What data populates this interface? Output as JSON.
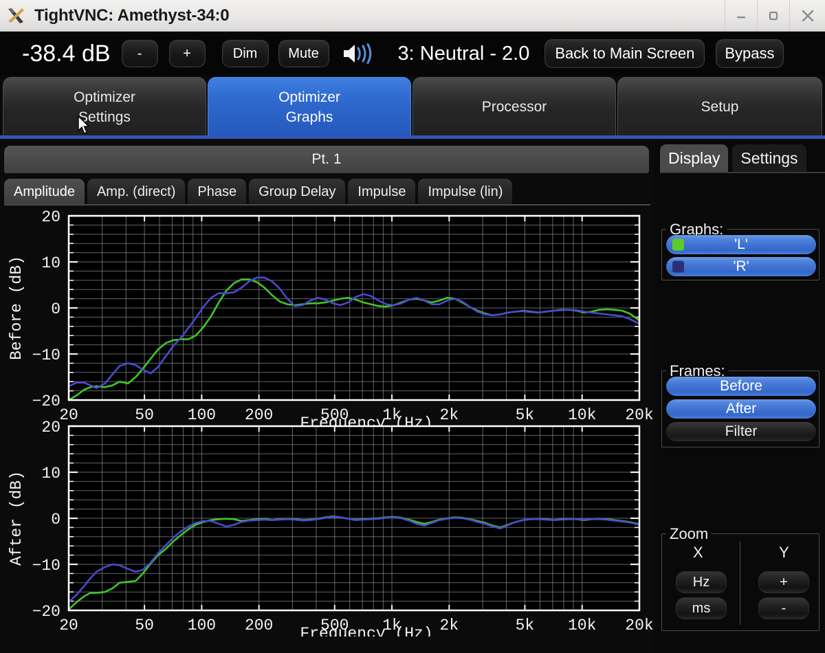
{
  "window": {
    "title": "TightVNC: Amethyst-34:0",
    "app_icon": "x-window-icon",
    "minimize_label": "–",
    "maximize_label": "□",
    "close_label": "✕"
  },
  "toolbar": {
    "volume_readout": "-38.4 dB",
    "decrease_label": "-",
    "increase_label": "+",
    "dim_label": "Dim",
    "mute_label": "Mute",
    "speaker_icon": "speaker-volume-icon",
    "preset_label": "3: Neutral - 2.0",
    "back_to_main_label": "Back to Main Screen",
    "bypass_label": "Bypass"
  },
  "main_tabs": [
    {
      "line1": "Optimizer",
      "line2": "Settings",
      "active": false
    },
    {
      "line1": "Optimizer",
      "line2": "Graphs",
      "active": true
    },
    {
      "line1": "Processor",
      "line2": "",
      "active": false
    },
    {
      "line1": "Setup",
      "line2": "",
      "active": false
    }
  ],
  "point_bar": {
    "label": "Pt. 1"
  },
  "sub_tabs": [
    {
      "label": "Amplitude",
      "active": true
    },
    {
      "label": "Amp. (direct)",
      "active": false
    },
    {
      "label": "Phase",
      "active": false
    },
    {
      "label": "Group Delay",
      "active": false
    },
    {
      "label": "Impulse",
      "active": false
    },
    {
      "label": "Impulse (lin)",
      "active": false
    }
  ],
  "sidebar": {
    "tabs": [
      {
        "label": "Display",
        "active": true
      },
      {
        "label": "Settings",
        "active": false
      }
    ],
    "graphs": {
      "legend": "Graphs:",
      "items": [
        {
          "label": "'L'",
          "active": true,
          "swatch": "#5ecb27"
        },
        {
          "label": "'R'",
          "active": true,
          "swatch": "#2b2f78"
        }
      ]
    },
    "frames": {
      "legend": "Frames:",
      "items": [
        {
          "label": "Before",
          "active": true
        },
        {
          "label": "After",
          "active": true
        },
        {
          "label": "Filter",
          "active": false
        }
      ]
    },
    "zoom": {
      "legend": "Zoom",
      "x_label": "X",
      "y_label": "Y",
      "x_buttons": [
        "Hz",
        "ms"
      ],
      "y_buttons": [
        "+",
        "-"
      ]
    }
  },
  "colors": {
    "accent_blue": "#3f7fe0",
    "separator_blue": "#3355bb",
    "series_l": "#3ec72a",
    "series_r": "#4a4ad0",
    "panel_bg": "#0b0b0b",
    "plot_bg": "#000000",
    "grid": "#8a8a8a"
  },
  "chart_data": [
    {
      "id": "before",
      "type": "line",
      "title": "",
      "xlabel": "Frequency (Hz)",
      "ylabel": "Before (dB)",
      "xscale": "log",
      "xlim": [
        20,
        20000
      ],
      "ylim": [
        -20,
        20
      ],
      "yticks": [
        20,
        10,
        0,
        -10,
        -20
      ],
      "xticks": [
        20,
        50,
        100,
        200,
        500,
        1000,
        2000,
        5000,
        10000,
        20000
      ],
      "xticklabels": [
        "20",
        "50",
        "100",
        "200",
        "500",
        "1k",
        "2k",
        "5k",
        "10k",
        "20k"
      ],
      "grid": true,
      "legend": "none",
      "x": [
        20,
        22,
        24,
        26,
        28,
        31,
        34,
        37,
        41,
        45,
        49,
        54,
        59,
        65,
        71,
        78,
        85,
        93,
        102,
        112,
        123,
        135,
        148,
        162,
        178,
        195,
        214,
        234,
        257,
        282,
        309,
        339,
        372,
        407,
        447,
        490,
        537,
        589,
        646,
        708,
        776,
        851,
        933,
        1023,
        1122,
        1230,
        1349,
        1479,
        1622,
        1778,
        1950,
        2138,
        2344,
        2570,
        2818,
        3090,
        3388,
        3715,
        4074,
        4467,
        4898,
        5370,
        5888,
        6457,
        7079,
        7762,
        8511,
        9330,
        10230,
        11220,
        12300,
        13490,
        14790,
        16220,
        17780,
        19500,
        20000
      ],
      "series": [
        {
          "name": "'L'",
          "color": "#3ec72a",
          "values": [
            -20.0,
            -19.0,
            -17.8,
            -17.2,
            -17.0,
            -17.2,
            -16.8,
            -16.0,
            -16.4,
            -15.0,
            -13.2,
            -11.0,
            -9.0,
            -7.6,
            -7.0,
            -6.8,
            -6.8,
            -6.0,
            -4.2,
            -1.8,
            1.2,
            3.8,
            5.4,
            6.2,
            6.2,
            5.6,
            4.4,
            2.8,
            1.4,
            0.8,
            0.6,
            0.8,
            1.0,
            1.0,
            1.2,
            1.6,
            2.0,
            2.2,
            1.8,
            1.2,
            0.8,
            0.4,
            0.3,
            0.6,
            1.2,
            1.8,
            2.0,
            1.6,
            1.2,
            1.6,
            2.2,
            2.0,
            1.2,
            0.2,
            -0.6,
            -1.2,
            -1.6,
            -1.4,
            -1.0,
            -0.8,
            -0.6,
            -0.8,
            -1.0,
            -0.8,
            -0.6,
            -0.4,
            -0.4,
            -0.6,
            -1.0,
            -0.8,
            -0.4,
            -0.3,
            -0.4,
            -0.6,
            -1.2,
            -2.4,
            -2.8
          ]
        },
        {
          "name": "'R'",
          "color": "#4a4ad0",
          "values": [
            -17.0,
            -16.2,
            -16.2,
            -16.8,
            -17.4,
            -16.4,
            -14.4,
            -12.6,
            -12.0,
            -12.4,
            -13.4,
            -14.2,
            -12.8,
            -10.4,
            -8.2,
            -6.4,
            -4.4,
            -2.2,
            0.2,
            2.2,
            3.2,
            3.2,
            3.4,
            4.4,
            5.8,
            6.6,
            6.6,
            5.8,
            4.2,
            2.0,
            0.4,
            0.6,
            1.6,
            2.2,
            1.8,
            1.0,
            0.6,
            1.2,
            2.4,
            3.0,
            2.6,
            1.6,
            0.8,
            0.6,
            1.0,
            1.8,
            2.2,
            1.6,
            0.8,
            0.8,
            1.6,
            2.0,
            1.4,
            0.2,
            -0.8,
            -1.4,
            -1.6,
            -1.4,
            -1.0,
            -0.8,
            -0.7,
            -0.9,
            -1.0,
            -0.8,
            -0.6,
            -0.5,
            -0.4,
            -0.5,
            -0.8,
            -1.0,
            -1.2,
            -1.4,
            -1.6,
            -1.8,
            -2.4,
            -3.2,
            -3.4
          ]
        }
      ]
    },
    {
      "id": "after",
      "type": "line",
      "title": "",
      "xlabel": "Frequency (Hz)",
      "ylabel": "After (dB)",
      "xscale": "log",
      "xlim": [
        20,
        20000
      ],
      "ylim": [
        -20,
        20
      ],
      "yticks": [
        20,
        10,
        0,
        -10,
        -20
      ],
      "xticks": [
        20,
        50,
        100,
        200,
        500,
        1000,
        2000,
        5000,
        10000,
        20000
      ],
      "xticklabels": [
        "20",
        "50",
        "100",
        "200",
        "500",
        "1k",
        "2k",
        "5k",
        "10k",
        "20k"
      ],
      "grid": true,
      "legend": "none",
      "x": [
        20,
        22,
        24,
        26,
        28,
        31,
        34,
        37,
        41,
        45,
        49,
        54,
        59,
        65,
        71,
        78,
        85,
        93,
        102,
        112,
        123,
        135,
        148,
        162,
        178,
        195,
        214,
        234,
        257,
        282,
        309,
        339,
        372,
        407,
        447,
        490,
        537,
        589,
        646,
        708,
        776,
        851,
        933,
        1023,
        1122,
        1230,
        1349,
        1479,
        1622,
        1778,
        1950,
        2138,
        2344,
        2570,
        2818,
        3090,
        3388,
        3715,
        4074,
        4467,
        4898,
        5370,
        5888,
        6457,
        7079,
        7762,
        8511,
        9330,
        10230,
        11220,
        12300,
        13490,
        14790,
        16220,
        17780,
        19500,
        20000
      ],
      "series": [
        {
          "name": "'L'",
          "color": "#3ec72a",
          "values": [
            -19.8,
            -18.2,
            -17.0,
            -16.2,
            -16.2,
            -16.0,
            -15.2,
            -14.0,
            -13.8,
            -13.6,
            -12.0,
            -9.8,
            -8.0,
            -6.6,
            -5.0,
            -3.6,
            -2.4,
            -1.4,
            -0.8,
            -0.4,
            -0.2,
            -0.1,
            -0.2,
            -0.6,
            -0.4,
            -0.2,
            -0.1,
            -0.4,
            -0.2,
            -0.1,
            -0.2,
            -0.4,
            -0.3,
            -0.1,
            0.2,
            0.4,
            0.2,
            -0.1,
            -0.3,
            -0.2,
            -0.1,
            0.0,
            0.2,
            0.3,
            0.1,
            -0.3,
            -0.8,
            -1.2,
            -0.8,
            -0.3,
            0.0,
            0.2,
            0.1,
            -0.2,
            -0.6,
            -1.0,
            -1.6,
            -2.0,
            -1.4,
            -0.8,
            -0.4,
            -0.2,
            -0.1,
            -0.2,
            -0.4,
            -0.2,
            -0.1,
            -0.2,
            -0.4,
            -0.2,
            -0.1,
            -0.2,
            -0.4,
            -0.6,
            -0.8,
            -1.2,
            -1.4
          ]
        },
        {
          "name": "'R'",
          "color": "#4a4ad0",
          "values": [
            -18.2,
            -16.6,
            -14.8,
            -13.0,
            -11.6,
            -10.6,
            -10.0,
            -10.2,
            -11.0,
            -11.6,
            -11.2,
            -9.6,
            -7.6,
            -5.8,
            -4.2,
            -2.8,
            -1.8,
            -1.0,
            -0.6,
            -0.6,
            -1.2,
            -1.8,
            -1.4,
            -0.8,
            -0.5,
            -0.4,
            -0.3,
            -0.4,
            -0.3,
            -0.2,
            -0.3,
            -0.5,
            -0.4,
            -0.2,
            0.1,
            0.3,
            0.2,
            -0.1,
            -0.4,
            -0.3,
            -0.2,
            -0.1,
            0.1,
            0.2,
            0.0,
            -0.5,
            -1.2,
            -1.6,
            -1.0,
            -0.4,
            -0.1,
            0.1,
            0.0,
            -0.3,
            -0.8,
            -1.2,
            -1.8,
            -2.2,
            -1.5,
            -0.8,
            -0.4,
            -0.2,
            -0.2,
            -0.3,
            -0.4,
            -0.3,
            -0.2,
            -0.2,
            -0.3,
            -0.2,
            -0.2,
            -0.3,
            -0.5,
            -0.7,
            -0.9,
            -1.3,
            -1.5
          ]
        }
      ]
    }
  ]
}
